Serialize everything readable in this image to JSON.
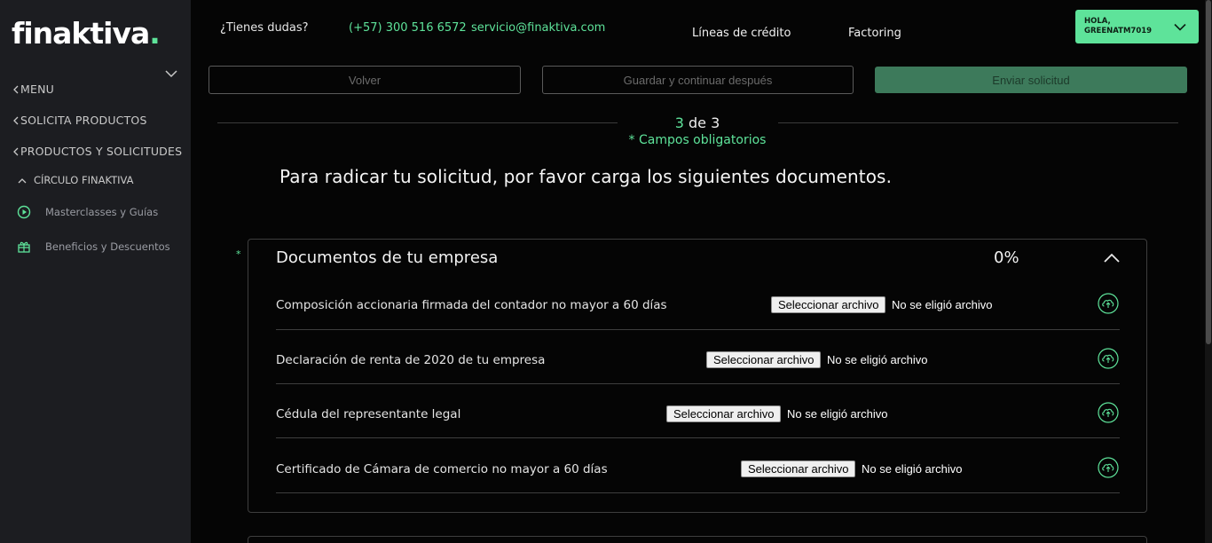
{
  "brand": {
    "logo_text": "finaktiva",
    "logo_dot": ".",
    "accent": "#5ee39a"
  },
  "sidebar": {
    "menu_label": "MENU",
    "items": [
      {
        "label": "SOLICITA PRODUCTOS"
      },
      {
        "label": "PRODUCTOS Y SOLICITUDES"
      }
    ],
    "section": {
      "label": "CÍRCULO FINAKTIVA",
      "icon": "chevron-up-icon"
    },
    "links": [
      {
        "label": "Masterclasses y Guías",
        "icon": "play-circle-icon"
      },
      {
        "label": "Beneficios y Descuentos",
        "icon": "gift-icon"
      }
    ]
  },
  "header": {
    "question": "¿Tienes dudas?",
    "phone": "(+57) 300 516 6572",
    "email": "servicio@finaktiva.com",
    "nav": [
      "Líneas de crédito",
      "Factoring"
    ],
    "user_greeting": "HOLA,",
    "user_name": "GREENATM7019"
  },
  "actions": {
    "back": "Volver",
    "save": "Guardar y continuar después",
    "submit": "Enviar solicitud"
  },
  "step": {
    "current": "3",
    "separator": "de",
    "total": "3",
    "required_note": "* Campos obligatorios"
  },
  "headline": "Para radicar tu solicitud, por favor carga los siguientes documentos.",
  "documents_card": {
    "required_mark": "*",
    "title": "Documentos de tu empresa",
    "progress": "0%",
    "rows": [
      {
        "label": "Composición accionaria firmada del contador no mayor a 60 días",
        "button": "Seleccionar archivo",
        "status": "No se eligió archivo"
      },
      {
        "label": "Declaración de renta de 2020 de tu empresa",
        "button": "Seleccionar archivo",
        "status": "No se eligió archivo"
      },
      {
        "label": "Cédula del representante legal",
        "button": "Seleccionar archivo",
        "status": "No se eligió archivo"
      },
      {
        "label": "Certificado de Cámara de comercio no mayor a 60 días",
        "button": "Seleccionar archivo",
        "status": "No se eligió archivo"
      }
    ]
  }
}
